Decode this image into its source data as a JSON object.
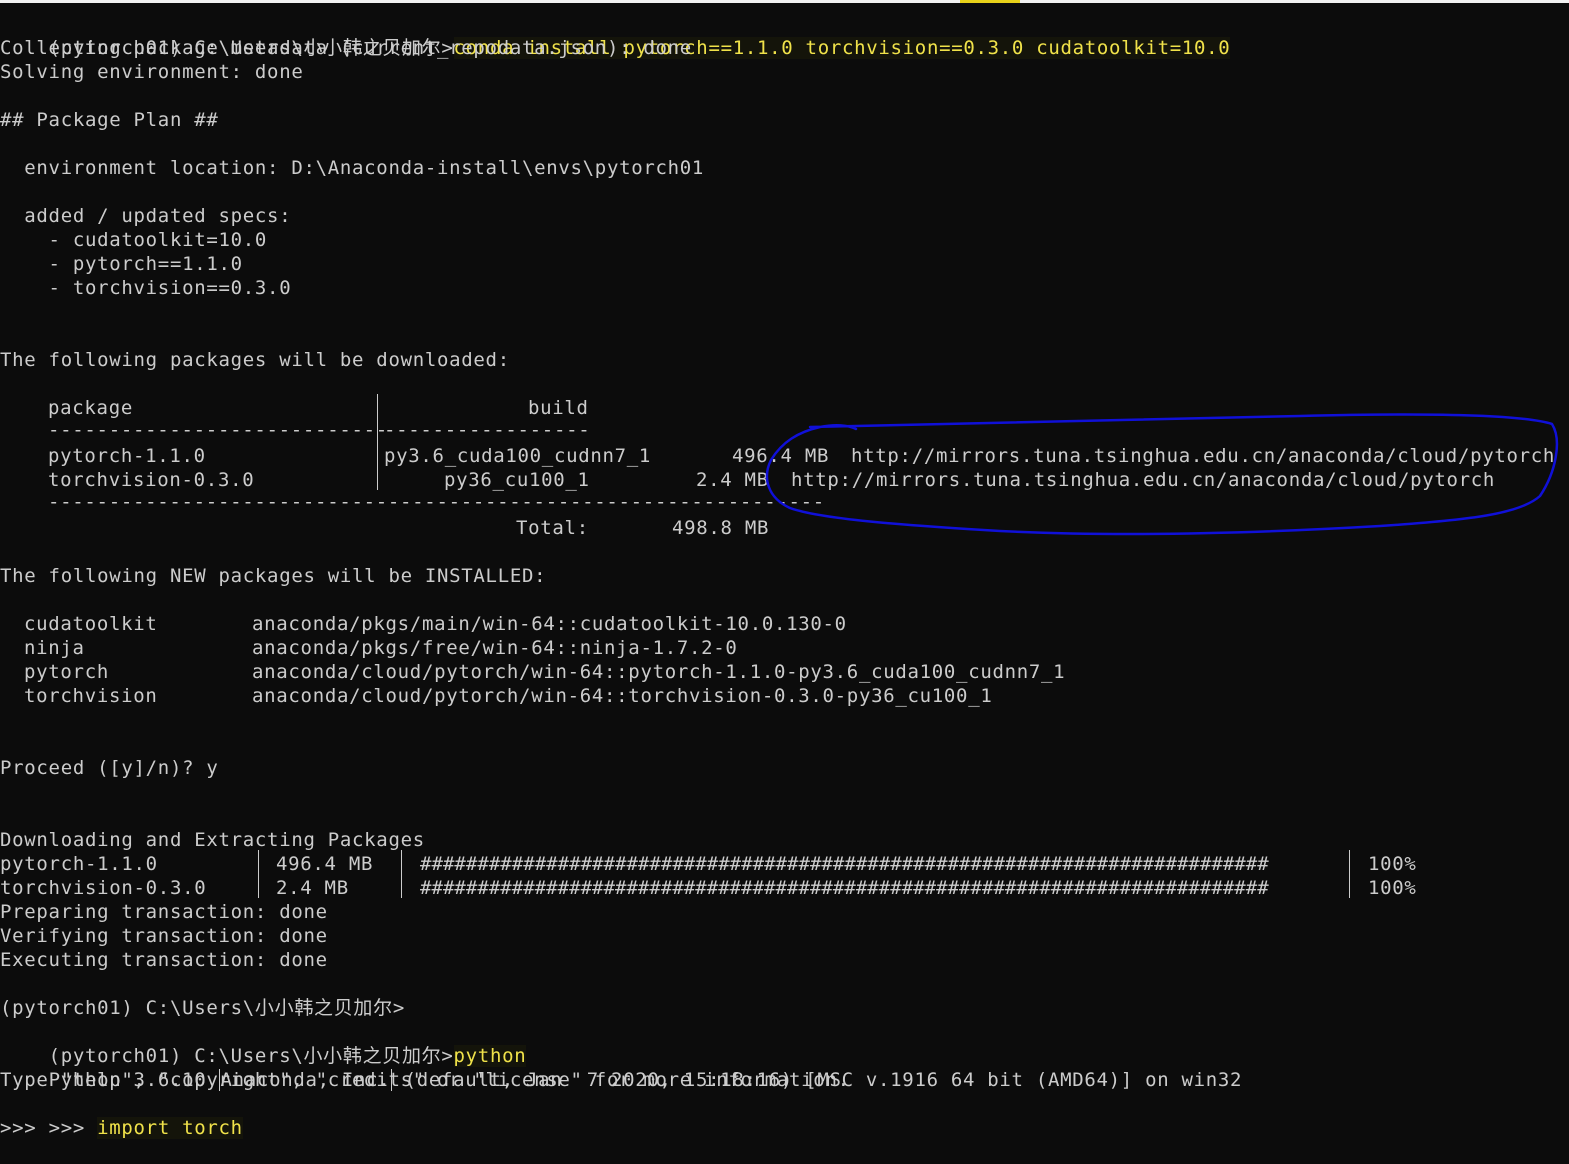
{
  "terminal": {
    "lines": [
      {
        "prompt": "(pytorch01) C:\\Users\\小小韩之贝加尔>",
        "command": "conda install pytorch==1.1.0 torchvision==0.3.0 cudatoolkit=10.0"
      },
      "Collecting package metadata (current_repodata.json): done",
      "Solving environment: done",
      "## Package Plan ##",
      "  environment location: D:\\Anaconda-install\\envs\\pytorch01",
      "  added / updated specs:",
      "    - cudatoolkit=10.0",
      "    - pytorch==1.1.0",
      "    - torchvision==0.3.0",
      "The following packages will be downloaded:"
    ],
    "download_table": {
      "headers": {
        "package": "package",
        "build": "build"
      },
      "header_rule_package": "----------------------------",
      "header_rule_build": "-----------------",
      "rows": [
        {
          "package": "pytorch-1.1.0",
          "build": "py3.6_cuda100_cudnn7_1",
          "size": "496.4 MB",
          "channel": "http://mirrors.tuna.tsinghua.edu.cn/anaconda/cloud/pytorch"
        },
        {
          "package": "torchvision-0.3.0",
          "build": "py36_cu100_1",
          "size": "2.4 MB",
          "channel": "http://mirrors.tuna.tsinghua.edu.cn/anaconda/cloud/pytorch"
        }
      ],
      "footer_rule": "----------------------------------------------------------------",
      "total_label": "Total:",
      "total_value": "498.8 MB"
    },
    "install_header": "The following NEW packages will be INSTALLED:",
    "install_list": [
      {
        "name": "cudatoolkit",
        "spec": "anaconda/pkgs/main/win-64::cudatoolkit-10.0.130-0"
      },
      {
        "name": "ninja",
        "spec": "anaconda/pkgs/free/win-64::ninja-1.7.2-0"
      },
      {
        "name": "pytorch",
        "spec": "anaconda/cloud/pytorch/win-64::pytorch-1.1.0-py3.6_cuda100_cudnn7_1"
      },
      {
        "name": "torchvision",
        "spec": "anaconda/cloud/pytorch/win-64::torchvision-0.3.0-py36_cu100_1"
      }
    ],
    "proceed_prompt": "Proceed ([y]/n)? y",
    "download_header": "Downloading and Extracting Packages",
    "progress_bar": "##########################################################################",
    "progress": [
      {
        "package": "pytorch-1.1.0",
        "size": "496.4 MB",
        "percent": "100%"
      },
      {
        "package": "torchvision-0.3.0",
        "size": "2.4 MB",
        "percent": "100%"
      }
    ],
    "transaction": [
      "Preparing transaction: done",
      "Verifying transaction: done",
      "Executing transaction: done"
    ],
    "prompt2": "(pytorch01) C:\\Users\\小小韩之贝加尔>",
    "prompt3": "(pytorch01) C:\\Users\\小小韩之贝加尔>",
    "python_cmd": "python",
    "python_version_a": "Python 3.6.10 ",
    "python_version_b": "Anaconda, Inc.",
    "python_version_c": " (default, Jan  7 2020, 15:18:16) [MSC v.1916 64 bit (AMD64)] on win32",
    "python_help": "Type \"help\", \"copyright\", \"credits\" or \"license\" for more information.",
    "repl_prompt": ">>> ",
    "repl_command": "import torch",
    "repl_prompt_empty": ">>>"
  },
  "colors": {
    "background": "#0c0c0c",
    "text": "#cccccc",
    "command": "#f0e24a",
    "annotation": "#1010d8"
  }
}
